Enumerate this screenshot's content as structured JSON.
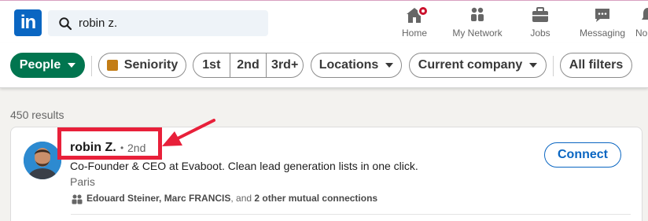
{
  "header": {
    "logo_text": "in",
    "search_value": "robin z.",
    "nav": [
      {
        "label": "Home",
        "icon": "home-icon"
      },
      {
        "label": "My Network",
        "icon": "network-icon"
      },
      {
        "label": "Jobs",
        "icon": "briefcase-icon"
      },
      {
        "label": "Messaging",
        "icon": "messaging-icon"
      },
      {
        "label": "No",
        "icon": "notifications-icon"
      }
    ]
  },
  "filters": {
    "people_label": "People",
    "seniority_label": "Seniority",
    "degree_options": [
      "1st",
      "2nd",
      "3rd+"
    ],
    "locations_label": "Locations",
    "current_company_label": "Current company",
    "all_filters_label": "All filters"
  },
  "results": {
    "count_text": "450 results",
    "items": [
      {
        "name": "robin Z.",
        "separator": "•",
        "degree": "2nd",
        "headline": "Co-Founder & CEO at Evaboot. Clean lead generation lists in one click.",
        "location": "Paris",
        "mutual_names": "Edouard Steiner, Marc FRANCIS",
        "mutual_joiner": ", and ",
        "mutual_others": "2 other mutual connections",
        "connect_label": "Connect"
      }
    ]
  },
  "colors": {
    "brand": "#0a66c2",
    "people_pill": "#01754f",
    "highlight": "#e8203a",
    "badge": "#cb112d"
  }
}
